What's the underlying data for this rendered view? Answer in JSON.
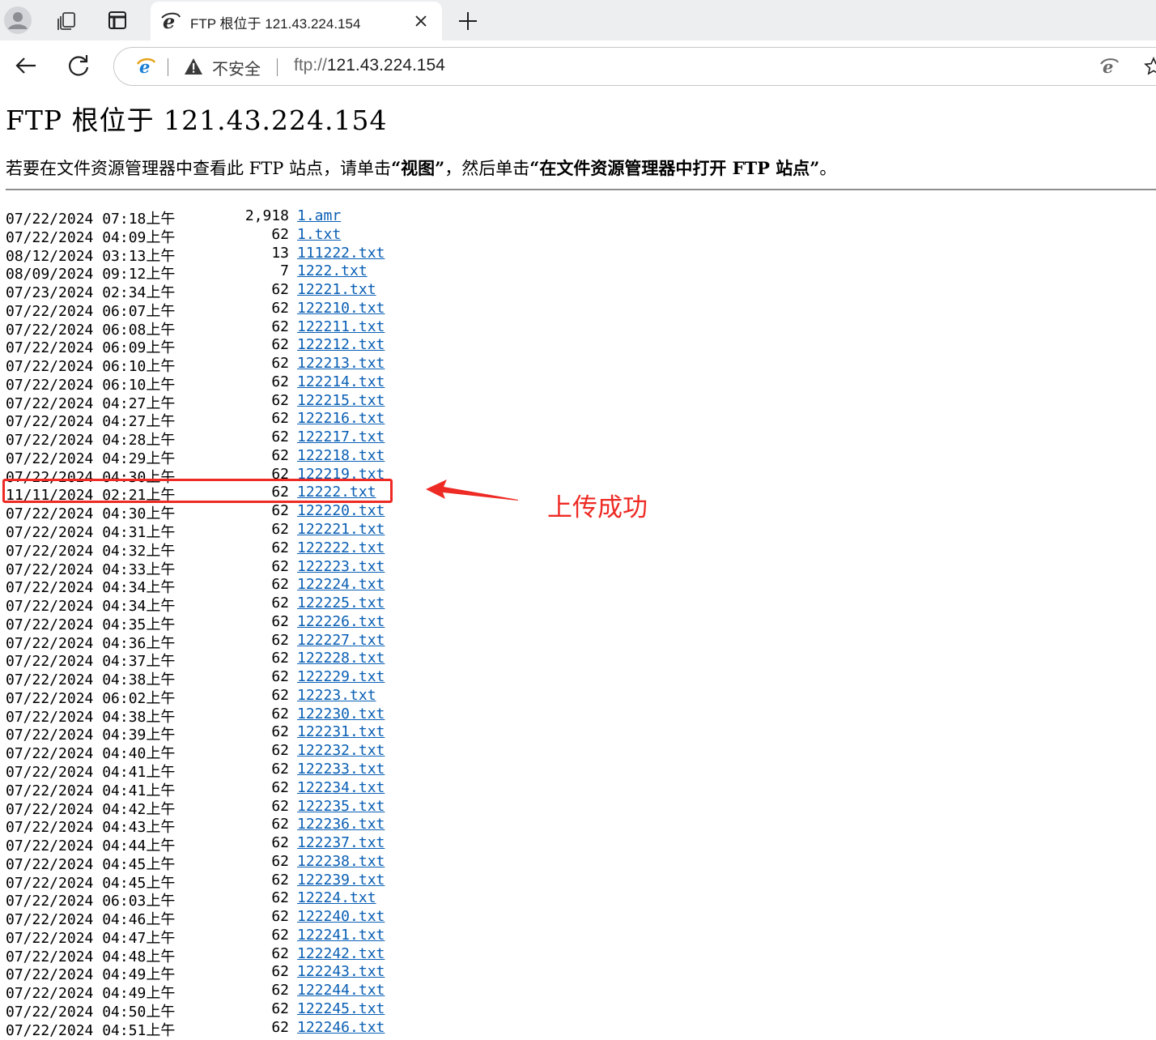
{
  "browser": {
    "tab": {
      "title": "FTP 根位于 121.43.224.154"
    },
    "address": {
      "insecure_label": "不安全",
      "scheme": "ftp://",
      "host": "121.43.224.154"
    },
    "icons": {
      "profile": "profile-icon",
      "workspaces": "workspaces-icon",
      "tab_actions": "tab-actions-icon",
      "favicon": "ie-icon",
      "close": "close-icon",
      "new_tab": "plus-icon",
      "back": "back-arrow-icon",
      "reload": "reload-icon",
      "warning": "warning-icon",
      "ie_mode": "ie-mode-icon",
      "favorite": "star-icon"
    }
  },
  "page": {
    "heading": "FTP 根位于 121.43.224.154",
    "instruction": {
      "pre": "若要在文件资源管理器中查看此 FTP 站点，请单击",
      "view": "“视图”",
      "mid": "，然后单击",
      "open": "“在文件资源管理器中打开 FTP 站点”",
      "end": "。"
    },
    "files": [
      {
        "dt": "07/22/2024 07:18上午",
        "size": "2,918",
        "name": "1.amr"
      },
      {
        "dt": "07/22/2024 04:09上午",
        "size": "62",
        "name": "1.txt"
      },
      {
        "dt": "08/12/2024 03:13上午",
        "size": "13",
        "name": "111222.txt"
      },
      {
        "dt": "08/09/2024 09:12上午",
        "size": "7",
        "name": "1222.txt"
      },
      {
        "dt": "07/23/2024 02:34上午",
        "size": "62",
        "name": "12221.txt"
      },
      {
        "dt": "07/22/2024 06:07上午",
        "size": "62",
        "name": "122210.txt"
      },
      {
        "dt": "07/22/2024 06:08上午",
        "size": "62",
        "name": "122211.txt"
      },
      {
        "dt": "07/22/2024 06:09上午",
        "size": "62",
        "name": "122212.txt"
      },
      {
        "dt": "07/22/2024 06:10上午",
        "size": "62",
        "name": "122213.txt"
      },
      {
        "dt": "07/22/2024 06:10上午",
        "size": "62",
        "name": "122214.txt"
      },
      {
        "dt": "07/22/2024 04:27上午",
        "size": "62",
        "name": "122215.txt"
      },
      {
        "dt": "07/22/2024 04:27上午",
        "size": "62",
        "name": "122216.txt"
      },
      {
        "dt": "07/22/2024 04:28上午",
        "size": "62",
        "name": "122217.txt"
      },
      {
        "dt": "07/22/2024 04:29上午",
        "size": "62",
        "name": "122218.txt"
      },
      {
        "dt": "07/22/2024 04:30上午",
        "size": "62",
        "name": "122219.txt"
      },
      {
        "dt": "11/11/2024 02:21上午",
        "size": "62",
        "name": "12222.txt"
      },
      {
        "dt": "07/22/2024 04:30上午",
        "size": "62",
        "name": "122220.txt"
      },
      {
        "dt": "07/22/2024 04:31上午",
        "size": "62",
        "name": "122221.txt"
      },
      {
        "dt": "07/22/2024 04:32上午",
        "size": "62",
        "name": "122222.txt"
      },
      {
        "dt": "07/22/2024 04:33上午",
        "size": "62",
        "name": "122223.txt"
      },
      {
        "dt": "07/22/2024 04:34上午",
        "size": "62",
        "name": "122224.txt"
      },
      {
        "dt": "07/22/2024 04:34上午",
        "size": "62",
        "name": "122225.txt"
      },
      {
        "dt": "07/22/2024 04:35上午",
        "size": "62",
        "name": "122226.txt"
      },
      {
        "dt": "07/22/2024 04:36上午",
        "size": "62",
        "name": "122227.txt"
      },
      {
        "dt": "07/22/2024 04:37上午",
        "size": "62",
        "name": "122228.txt"
      },
      {
        "dt": "07/22/2024 04:38上午",
        "size": "62",
        "name": "122229.txt"
      },
      {
        "dt": "07/22/2024 06:02上午",
        "size": "62",
        "name": "12223.txt"
      },
      {
        "dt": "07/22/2024 04:38上午",
        "size": "62",
        "name": "122230.txt"
      },
      {
        "dt": "07/22/2024 04:39上午",
        "size": "62",
        "name": "122231.txt"
      },
      {
        "dt": "07/22/2024 04:40上午",
        "size": "62",
        "name": "122232.txt"
      },
      {
        "dt": "07/22/2024 04:41上午",
        "size": "62",
        "name": "122233.txt"
      },
      {
        "dt": "07/22/2024 04:41上午",
        "size": "62",
        "name": "122234.txt"
      },
      {
        "dt": "07/22/2024 04:42上午",
        "size": "62",
        "name": "122235.txt"
      },
      {
        "dt": "07/22/2024 04:43上午",
        "size": "62",
        "name": "122236.txt"
      },
      {
        "dt": "07/22/2024 04:44上午",
        "size": "62",
        "name": "122237.txt"
      },
      {
        "dt": "07/22/2024 04:45上午",
        "size": "62",
        "name": "122238.txt"
      },
      {
        "dt": "07/22/2024 04:45上午",
        "size": "62",
        "name": "122239.txt"
      },
      {
        "dt": "07/22/2024 06:03上午",
        "size": "62",
        "name": "12224.txt"
      },
      {
        "dt": "07/22/2024 04:46上午",
        "size": "62",
        "name": "122240.txt"
      },
      {
        "dt": "07/22/2024 04:47上午",
        "size": "62",
        "name": "122241.txt"
      },
      {
        "dt": "07/22/2024 04:48上午",
        "size": "62",
        "name": "122242.txt"
      },
      {
        "dt": "07/22/2024 04:49上午",
        "size": "62",
        "name": "122243.txt"
      },
      {
        "dt": "07/22/2024 04:49上午",
        "size": "62",
        "name": "122244.txt"
      },
      {
        "dt": "07/22/2024 04:50上午",
        "size": "62",
        "name": "122245.txt"
      },
      {
        "dt": "07/22/2024 04:51上午",
        "size": "62",
        "name": "122246.txt"
      }
    ],
    "link_color": "#0a5fb4"
  },
  "annotation": {
    "label": "上传成功",
    "color": "#ee2a24"
  }
}
